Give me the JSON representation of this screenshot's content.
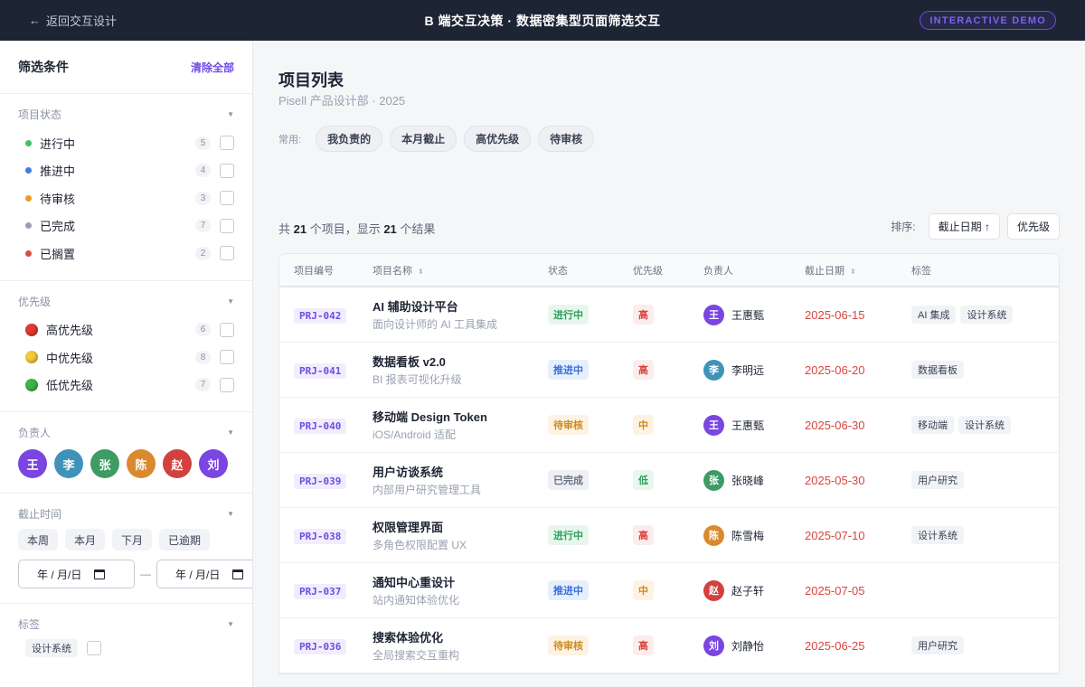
{
  "topbar": {
    "back_label": "返回交互设计",
    "title": "B 端交互决策 · 数据密集型页面筛选交互",
    "badge": "INTERACTIVE DEMO"
  },
  "sidebar": {
    "title": "筛选条件",
    "clear_all": "清除全部",
    "status": {
      "title": "项目状态",
      "items": [
        {
          "label": "进行中",
          "count": "5",
          "color": "#3fbf6a"
        },
        {
          "label": "推进中",
          "count": "4",
          "color": "#4a78e0"
        },
        {
          "label": "待审核",
          "count": "3",
          "color": "#e59a2b"
        },
        {
          "label": "已完成",
          "count": "7",
          "color": "#97a0b0"
        },
        {
          "label": "已搁置",
          "count": "2",
          "color": "#de4a43"
        }
      ]
    },
    "priority": {
      "title": "优先级",
      "items": [
        {
          "label": "高优先级",
          "count": "6",
          "color": "#e03a32"
        },
        {
          "label": "中优先级",
          "count": "8",
          "color": "#f5c93a"
        },
        {
          "label": "低优先级",
          "count": "7",
          "color": "#3db54a"
        }
      ]
    },
    "owner": {
      "title": "负责人",
      "avatars": [
        {
          "name": "王",
          "color": "#7a45e0"
        },
        {
          "name": "李",
          "color": "#3f93b8"
        },
        {
          "name": "张",
          "color": "#3c9c63"
        },
        {
          "name": "陈",
          "color": "#d98a2e"
        },
        {
          "name": "赵",
          "color": "#d2413c"
        },
        {
          "name": "刘",
          "color": "#7a45e0"
        }
      ]
    },
    "deadline": {
      "title": "截止时间",
      "chips": [
        "本周",
        "本月",
        "下月",
        "已逾期"
      ],
      "from_placeholder": "年 / 月/日",
      "to_placeholder": "年 / 月/日",
      "separator": "—"
    },
    "tags": {
      "title": "标签",
      "items": [
        {
          "label": "设计系统"
        }
      ]
    }
  },
  "main": {
    "title": "项目列表",
    "subtitle": "Pisell 产品设计部 · 2025",
    "quick_label": "常用:",
    "quick_filters": [
      "我负责的",
      "本月截止",
      "高优先级",
      "待审核"
    ],
    "summary": {
      "p1": "共 ",
      "total": "21",
      "p2": " 个项目，显示 ",
      "shown": "21",
      "p3": " 个结果"
    },
    "sort_label": "排序:",
    "sort_buttons": [
      {
        "label": "截止日期 ↑"
      },
      {
        "label": "优先级"
      }
    ],
    "columns": [
      "项目编号",
      "项目名称",
      "状态",
      "优先级",
      "负责人",
      "截止日期",
      "标签"
    ],
    "rows": [
      {
        "id": "PRJ-042",
        "name": "AI 辅助设计平台",
        "desc": "面向设计师的 AI 工具集成",
        "status": "进行中",
        "st": "run",
        "priority": "高",
        "pr": "h",
        "owner": "王惠甄",
        "avatar": "王",
        "av_color": "#7a45e0",
        "due": "2025-06-15",
        "tags": [
          "AI 集成",
          "设计系统"
        ]
      },
      {
        "id": "PRJ-041",
        "name": "数据看板 v2.0",
        "desc": "BI 报表可视化升级",
        "status": "推进中",
        "st": "push",
        "priority": "高",
        "pr": "h",
        "owner": "李明远",
        "avatar": "李",
        "av_color": "#3f93b8",
        "due": "2025-06-20",
        "tags": [
          "数据看板"
        ]
      },
      {
        "id": "PRJ-040",
        "name": "移动端 Design Token",
        "desc": "iOS/Android 适配",
        "status": "待审核",
        "st": "wait",
        "priority": "中",
        "pr": "m",
        "owner": "王惠甄",
        "avatar": "王",
        "av_color": "#7a45e0",
        "due": "2025-06-30",
        "tags": [
          "移动端",
          "设计系统"
        ]
      },
      {
        "id": "PRJ-039",
        "name": "用户访谈系统",
        "desc": "内部用户研究管理工具",
        "status": "已完成",
        "st": "done",
        "priority": "低",
        "pr": "l",
        "owner": "张晓峰",
        "avatar": "张",
        "av_color": "#3c9c63",
        "due": "2025-05-30",
        "tags": [
          "用户研究"
        ]
      },
      {
        "id": "PRJ-038",
        "name": "权限管理界面",
        "desc": "多角色权限配置 UX",
        "status": "进行中",
        "st": "run",
        "priority": "高",
        "pr": "h",
        "owner": "陈雪梅",
        "avatar": "陈",
        "av_color": "#d98a2e",
        "due": "2025-07-10",
        "tags": [
          "设计系统"
        ]
      },
      {
        "id": "PRJ-037",
        "name": "通知中心重设计",
        "desc": "站内通知体验优化",
        "status": "推进中",
        "st": "push",
        "priority": "中",
        "pr": "m",
        "owner": "赵子轩",
        "avatar": "赵",
        "av_color": "#d2413c",
        "due": "2025-07-05",
        "tags": []
      },
      {
        "id": "PRJ-036",
        "name": "搜索体验优化",
        "desc": "全局搜索交互重构",
        "status": "待审核",
        "st": "wait",
        "priority": "高",
        "pr": "h",
        "owner": "刘静怡",
        "avatar": "刘",
        "av_color": "#7a45e0",
        "due": "2025-06-25",
        "tags": [
          "用户研究"
        ]
      }
    ]
  }
}
